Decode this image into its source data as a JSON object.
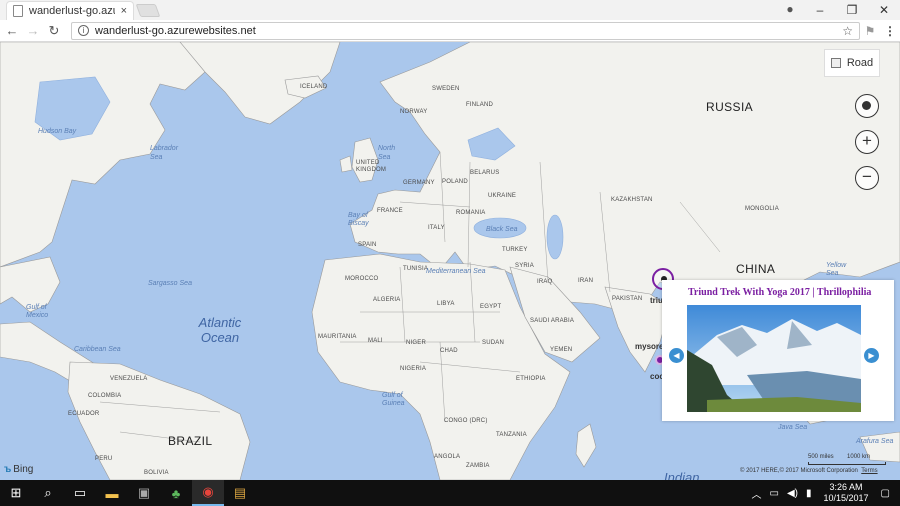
{
  "browser": {
    "tab_title": "wanderlust-go.azureweb",
    "tab_close": "×",
    "url": "wanderlust-go.azurewebsites.net",
    "window_controls": {
      "minimize": "–",
      "maximize": "❐",
      "close": "✕"
    },
    "icons": [
      "back-icon",
      "forward-icon",
      "reload-icon",
      "info-icon",
      "star-icon",
      "extension-icon",
      "menu-icon",
      "account-icon"
    ]
  },
  "map": {
    "style_button": "Road",
    "countries": [
      "RUSSIA",
      "CHINA",
      "BRAZIL",
      "KAZAKHSTAN",
      "MONGOLIA",
      "GERMANY",
      "FRANCE",
      "SPAIN",
      "POLAND",
      "UKRAINE",
      "BELARUS",
      "ROMANIA",
      "ITALY",
      "TURKEY",
      "SYRIA",
      "IRAQ",
      "IRAN",
      "PAKISTAN",
      "SWEDEN",
      "NORWAY",
      "FINLAND",
      "ICELAND",
      "UNITED KINGDOM",
      "MOROCCO",
      "ALGERIA",
      "TUNISIA",
      "LIBYA",
      "EGYPT",
      "SAUDI ARABIA",
      "YEMEN",
      "MAURITANIA",
      "MALI",
      "NIGER",
      "CHAD",
      "SUDAN",
      "ETHIOPIA",
      "NIGERIA",
      "CONGO (DRC)",
      "TANZANIA",
      "ANGOLA",
      "ZAMBIA",
      "VENEZUELA",
      "COLOMBIA",
      "ECUADOR",
      "PERU",
      "BOLIVIA"
    ],
    "seas": [
      "Hudson Bay",
      "Labrador Sea",
      "North Sea",
      "Bay of Biscay",
      "Sargasso Sea",
      "Gulf of Mexico",
      "Caribbean Sea",
      "Mediterranean Sea",
      "Black Sea",
      "Gulf of Guinea",
      "Yellow Sea",
      "Java Sea",
      "Arafura Sea"
    ],
    "ocean": "Atlantic Ocean",
    "indian": "Indian",
    "pins": [
      {
        "label": "triund",
        "color": "#7b1fa2"
      },
      {
        "label": "mysore",
        "color": "#7b1fa2"
      },
      {
        "label": "coo",
        "color": "#7b1fa2"
      }
    ],
    "popup": {
      "title": "Triund Trek With Yoga 2017 | Thrillophilia",
      "prev": "◀",
      "next": "▶"
    },
    "attribution": "Bing",
    "scale_miles": "500 miles",
    "scale_km": "1000 km",
    "copyright": "© 2017 HERE,© 2017 Microsoft Corporation",
    "terms": "Terms"
  },
  "taskbar": {
    "time": "3:26 AM",
    "date": "10/15/2017",
    "items": [
      "start-icon",
      "search-icon",
      "task-view-icon",
      "file-explorer-icon",
      "terminal-icon",
      "clover-app-icon",
      "chrome-icon",
      "media-app-icon"
    ]
  }
}
